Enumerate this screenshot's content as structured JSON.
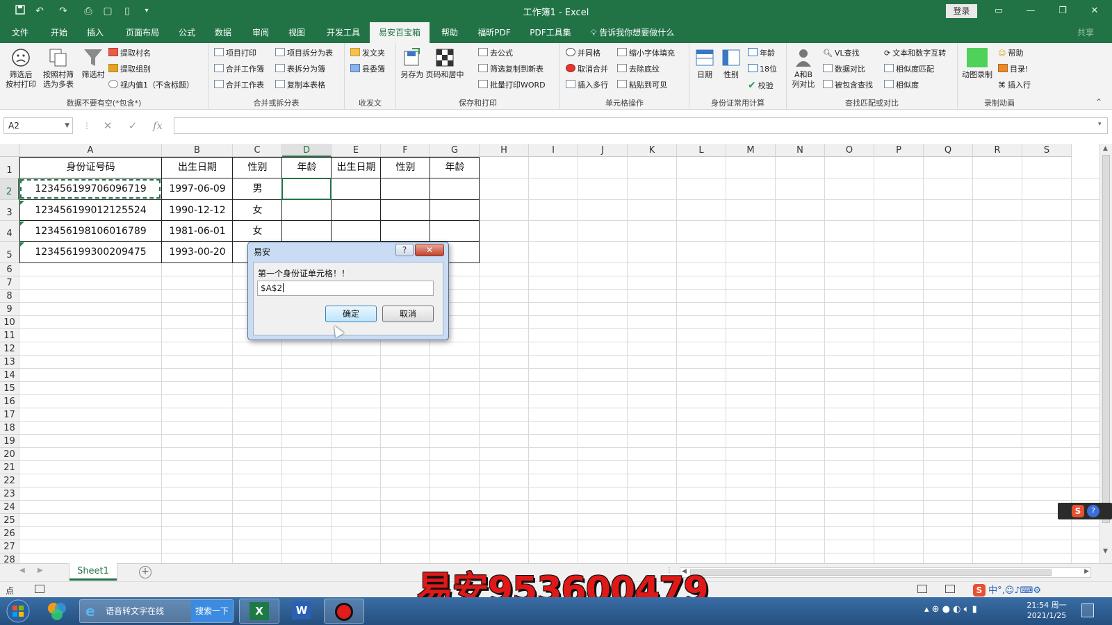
{
  "window": {
    "title": "工作簿1  -  Excel",
    "login_label": "登录",
    "quick_access": [
      "save-icon",
      "undo-icon",
      "redo-icon",
      "print-icon",
      "print-preview-icon",
      "new-icon",
      "customize-icon"
    ]
  },
  "menu": {
    "tabs": [
      "文件",
      "开始",
      "插入",
      "页面布局",
      "公式",
      "数据",
      "审阅",
      "视图",
      "开发工具",
      "易安百宝箱",
      "帮助",
      "福昕PDF",
      "PDF工具集"
    ],
    "active_tab": "易安百宝箱",
    "tell_me": "告诉我你想要做什么",
    "share": "共享"
  },
  "ribbon": {
    "groups": [
      {
        "label": "数据不要有空(*包含*)",
        "big": [
          {
            "line1": "筛选后",
            "line2": "按村打印"
          },
          {
            "line1": "按照村筛",
            "line2": "选为多表"
          },
          {
            "line1": "筛选村",
            "line2": ""
          }
        ],
        "small": [
          "提取村名",
          "提取组别",
          "视内值1（不含标题）"
        ]
      },
      {
        "label": "合并或拆分表",
        "small": [
          "项目打印",
          "合并工作簿",
          "合并工作表",
          "项目拆分为表",
          "表拆分为簿",
          "复制本表格"
        ]
      },
      {
        "label": "收发文",
        "small": [
          "发文夹",
          "县委簿"
        ]
      },
      {
        "label": "保存和打印",
        "big": [
          {
            "line1": "另存为",
            "line2": ""
          },
          {
            "line1": "页码和居中",
            "line2": ""
          }
        ],
        "small": [
          "去公式",
          "筛选复制到新表",
          "批量打印WORD"
        ]
      },
      {
        "label": "单元格操作",
        "small": [
          "并同格",
          "取消合并",
          "插入多行",
          "缩小字体填充",
          "去除底纹",
          "粘贴到可见"
        ]
      },
      {
        "label": "身份证常用计算",
        "big": [
          {
            "line1": "日期",
            "line2": ""
          },
          {
            "line1": "性别",
            "line2": ""
          }
        ],
        "small": [
          "年龄",
          "18位",
          "校验"
        ]
      },
      {
        "label": "查找匹配或对比",
        "big": [
          {
            "line1": "A和B",
            "line2": "列对比"
          }
        ],
        "small": [
          "VL查找",
          "数据对比",
          "被包含查找",
          "文本和数字互转",
          "相似度匹配",
          "相似度"
        ]
      },
      {
        "label": "录制动画",
        "big": [
          {
            "line1": "动图录制",
            "line2": ""
          }
        ],
        "small": [
          "帮助",
          "目录!",
          "插入行"
        ]
      }
    ]
  },
  "formula_bar": {
    "name_box": "A2",
    "formula": ""
  },
  "sheet": {
    "columns": [
      "A",
      "B",
      "C",
      "D",
      "E",
      "F",
      "G",
      "H",
      "I",
      "J",
      "K",
      "L",
      "M",
      "N",
      "O",
      "P",
      "Q",
      "R",
      "S"
    ],
    "rows": [
      "1",
      "2",
      "3",
      "4",
      "5",
      "6",
      "7",
      "8",
      "9",
      "10",
      "11",
      "12",
      "13",
      "14",
      "15",
      "16",
      "17",
      "18",
      "19",
      "20",
      "21",
      "22",
      "23",
      "24",
      "25",
      "26",
      "27",
      "28"
    ],
    "header_row": [
      "身份证号码",
      "出生日期",
      "性别",
      "年龄",
      "出生日期",
      "性别",
      "年龄"
    ],
    "data": [
      [
        "123456199706096719",
        "1997-06-09",
        "男"
      ],
      [
        "123456199012125524",
        "1990-12-12",
        "女"
      ],
      [
        "123456198106016789",
        "1981-06-01",
        "女"
      ],
      [
        "123456199300209475",
        "1993-00-20",
        ""
      ]
    ],
    "active_sheet": "Sheet1"
  },
  "dialog": {
    "title": "易安",
    "help_label": "?",
    "close_label": "✕",
    "prompt": "第一个身份证单元格！！",
    "input_value": "$A$2",
    "ok_label": "确定",
    "cancel_label": "取消"
  },
  "status": {
    "mode": "点"
  },
  "watermark": "易安953600479",
  "taskbar": {
    "ie_label": "语音转文字在线",
    "search_label": "搜索一下",
    "time": "21:54 周一",
    "date": "2021/1/25"
  }
}
